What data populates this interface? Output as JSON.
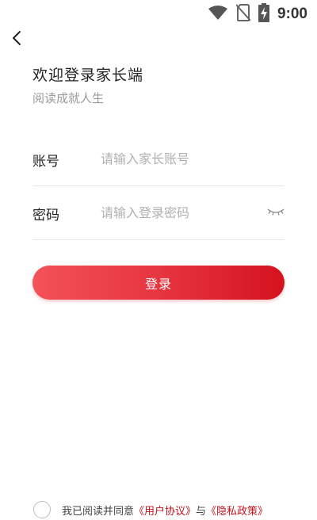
{
  "status_bar": {
    "time": "9:00",
    "icons": [
      "wifi-icon",
      "no-sim-icon",
      "battery-charging-icon"
    ]
  },
  "header": {
    "back_icon": "chevron-left-icon"
  },
  "title": "欢迎登录家长端",
  "subtitle": "阅读成就人生",
  "form": {
    "account": {
      "label": "账号",
      "placeholder": "请输入家长账号",
      "value": ""
    },
    "password": {
      "label": "密码",
      "placeholder": "请输入登录密码",
      "value": "",
      "toggle_icon": "eye-closed-icon"
    }
  },
  "login_button": "登录",
  "agreement": {
    "prefix": "我已阅读并同意",
    "user_agreement": "《用户协议》",
    "conjunction": "与",
    "privacy_policy": "《隐私政策》",
    "checked": false
  },
  "colors": {
    "accent": "#d4121e",
    "accent_light": "#f35258",
    "link": "#c0141e"
  }
}
